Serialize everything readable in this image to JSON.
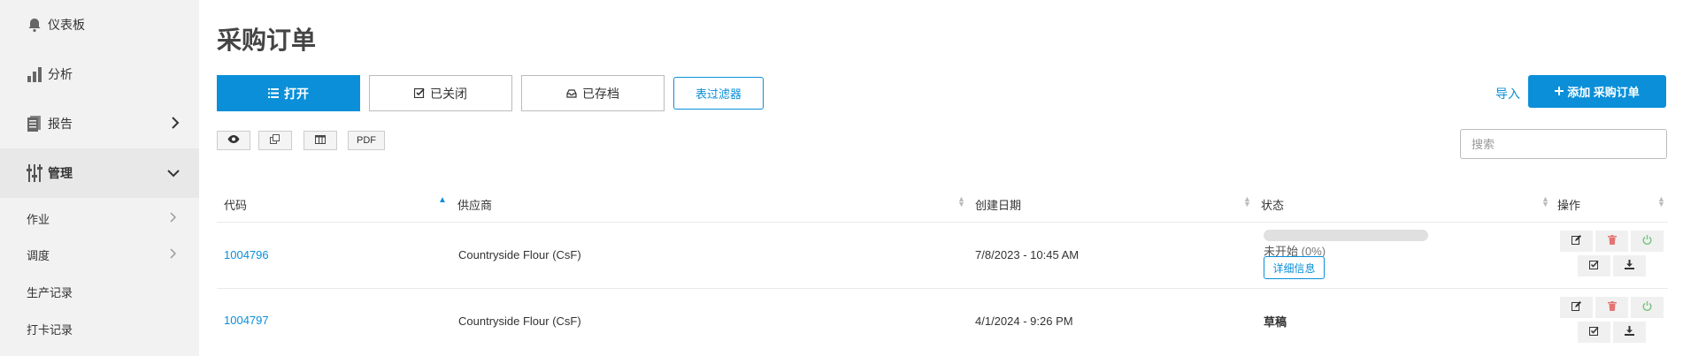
{
  "sidebar": {
    "items": [
      {
        "label": "仪表板",
        "icon": "bell-icon"
      },
      {
        "label": "分析",
        "icon": "bar-chart-icon"
      },
      {
        "label": "报告",
        "icon": "report-icon"
      },
      {
        "label": "管理",
        "icon": "sliders-icon"
      }
    ],
    "sub_items": [
      {
        "label": "作业"
      },
      {
        "label": "调度"
      },
      {
        "label": "生产记录"
      },
      {
        "label": "打卡记录"
      }
    ]
  },
  "page": {
    "title": "采购订单"
  },
  "tabs": [
    {
      "label": "打开",
      "icon": "list-icon"
    },
    {
      "label": "已关闭",
      "icon": "check-square-icon"
    },
    {
      "label": "已存档",
      "icon": "inbox-icon"
    }
  ],
  "filter_label": "表过滤器",
  "import_label": "导入",
  "add_label": "添加 采购订单",
  "toolbar": {
    "pdf_label": "PDF"
  },
  "search": {
    "placeholder": "搜索"
  },
  "table": {
    "headers": [
      "代码",
      "供应商",
      "创建日期",
      "状态",
      "操作"
    ],
    "rows": [
      {
        "code": "1004796",
        "supplier": "Countryside Flour (CsF)",
        "date": "7/8/2023 - 10:45 AM",
        "status": "未开始",
        "pct": "(0%)",
        "detail": "详细信息",
        "progress": 0
      },
      {
        "code": "1004797",
        "supplier": "Countryside Flour (CsF)",
        "date": "4/1/2024 - 9:26 PM",
        "status": "草稿"
      }
    ]
  },
  "colors": {
    "accent": "#0a8fd8",
    "sidebar_bg": "#f2f2f2"
  }
}
